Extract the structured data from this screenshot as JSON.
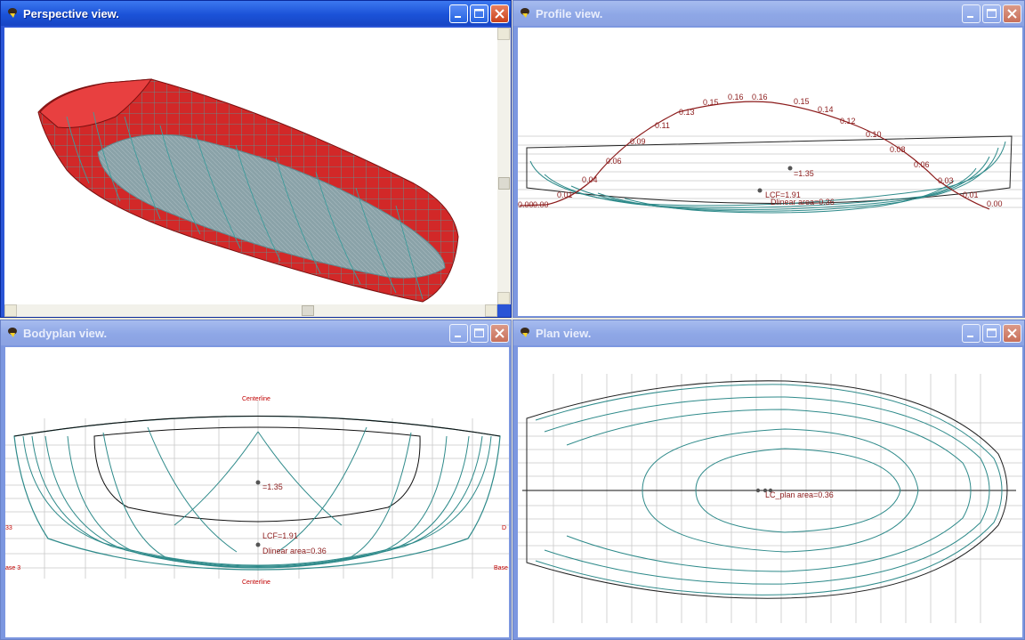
{
  "windows": {
    "perspective": {
      "title": "Perspective view."
    },
    "profile": {
      "title": "Profile view.",
      "area_curve_values": [
        "0.00",
        "0.00",
        "0.01",
        "0.04",
        "0.06",
        "0.09",
        "0.11",
        "0.13",
        "0.15",
        "0.16",
        "0.16",
        "0.15",
        "0.14",
        "0.12",
        "0.10",
        "0.08",
        "0.06",
        "0.03",
        "0.01",
        "0.00"
      ],
      "cob_label": "=1.35",
      "lcf_label": "LCF=1.91",
      "area_label": "Dlinear area=0.36"
    },
    "bodyplan": {
      "title": "Bodyplan view.",
      "centerline_top": "Centerline",
      "centerline_bottom": "Centerline",
      "cob_label": "=1.35",
      "lcf_label": "LCF=1.91",
      "area_label": "Dlinear area=0.36",
      "left_edge": "33",
      "right_edge": "D",
      "base_left": "ase 3",
      "base_right": "Base"
    },
    "plan": {
      "title": "Plan view.",
      "center_label": "LC_plan area=0.36"
    }
  },
  "colors": {
    "title_active": "#1f55dc",
    "title_inactive": "#8ea7e6",
    "hull_red": "#d62a2a",
    "station_teal": "#2e8a8a",
    "curve_red": "#8b1a1a"
  }
}
